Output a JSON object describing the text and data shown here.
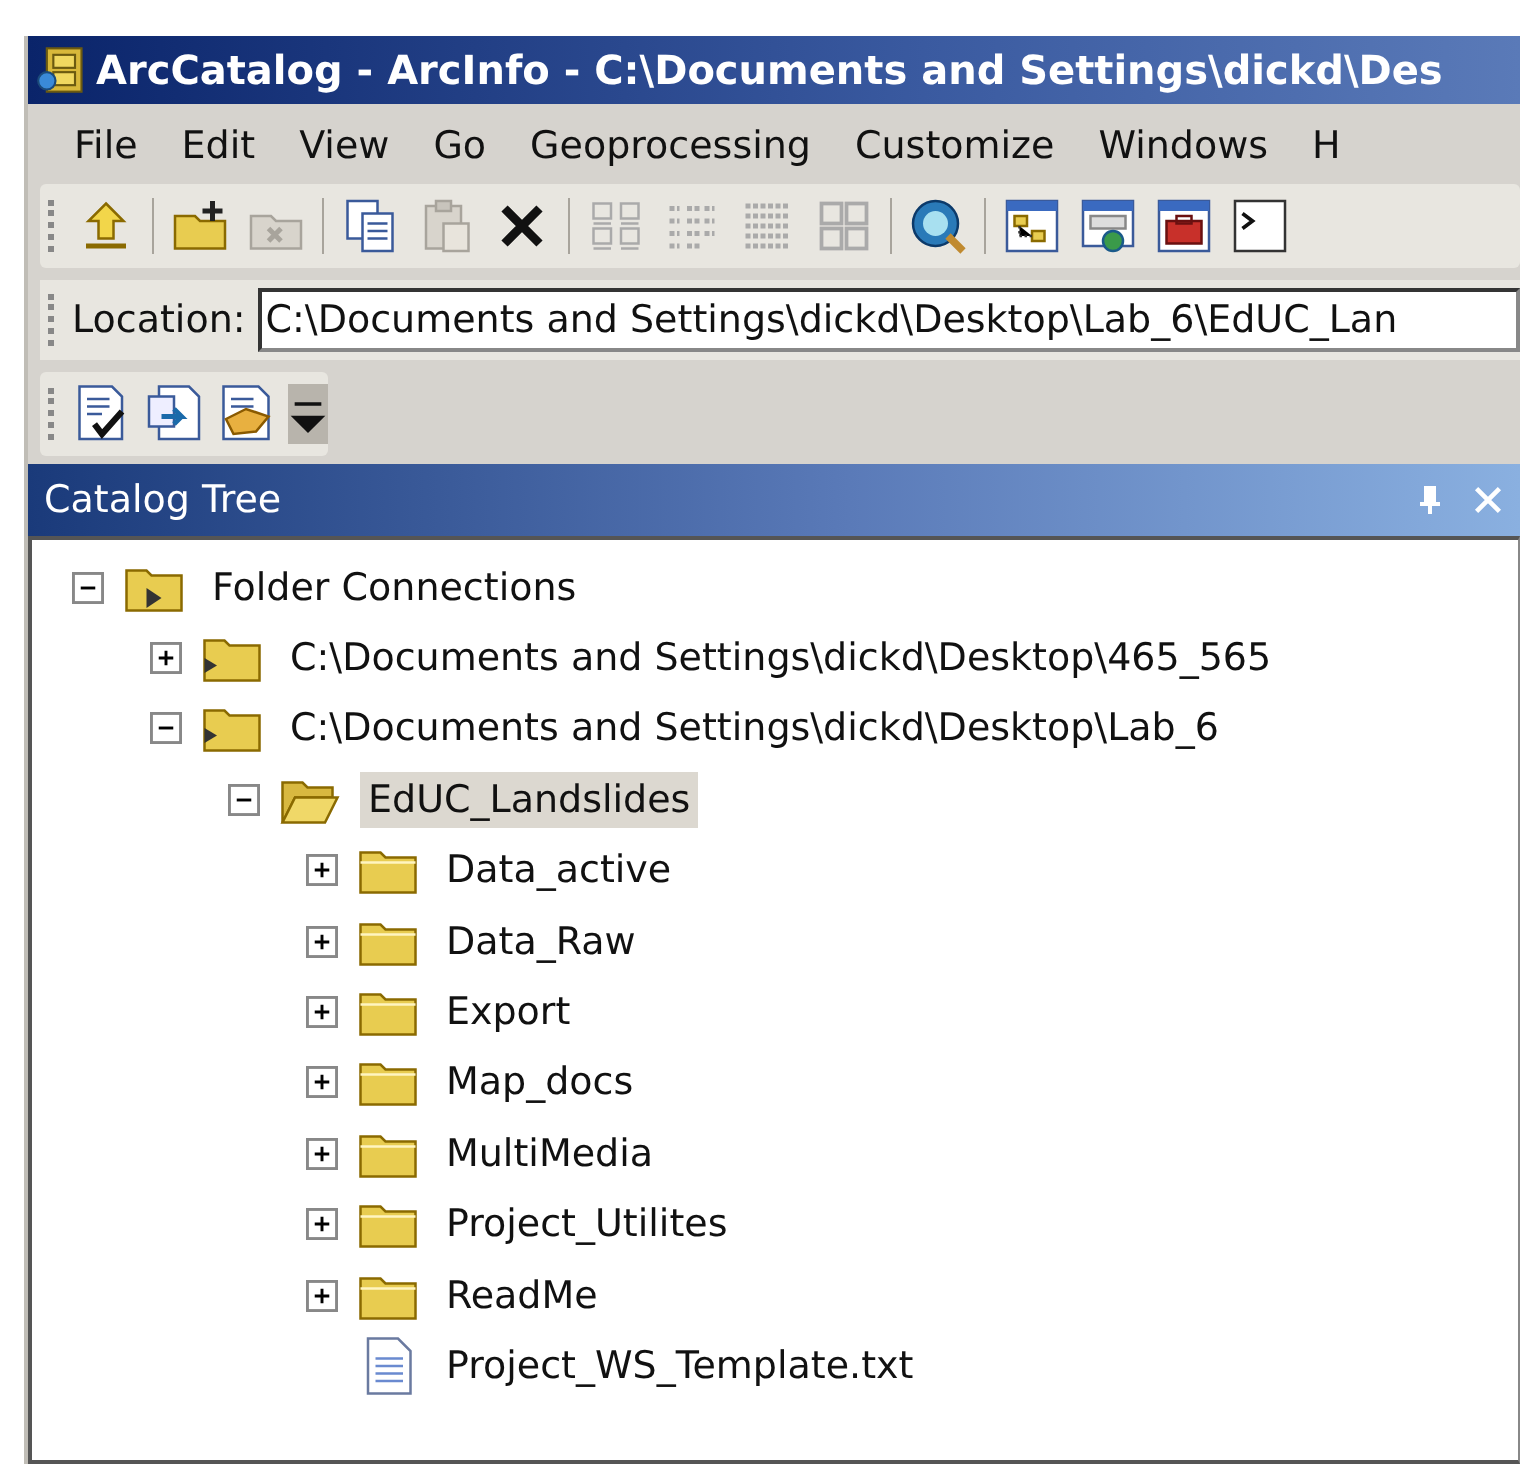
{
  "window": {
    "title": "ArcCatalog - ArcInfo - C:\\Documents and Settings\\dickd\\Des"
  },
  "menu": [
    "File",
    "Edit",
    "View",
    "Go",
    "Geoprocessing",
    "Customize",
    "Windows",
    "H"
  ],
  "location": {
    "label": "Location:",
    "value": "C:\\Documents and Settings\\dickd\\Desktop\\Lab_6\\EdUC_Lan"
  },
  "catalog_tree": {
    "title": "Catalog Tree",
    "items": [
      {
        "label": "Folder Connections",
        "kind": "connections",
        "expanded": true,
        "selected": false,
        "children": [
          {
            "label": "C:\\Documents and Settings\\dickd\\Desktop\\465_565",
            "kind": "connection",
            "expanded": false,
            "selected": false
          },
          {
            "label": "C:\\Documents and Settings\\dickd\\Desktop\\Lab_6",
            "kind": "connection",
            "expanded": true,
            "selected": false,
            "children": [
              {
                "label": "EdUC_Landslides",
                "kind": "folder",
                "expanded": true,
                "selected": true,
                "children": [
                  {
                    "label": "Data_active",
                    "kind": "folder",
                    "expanded": false,
                    "selected": false
                  },
                  {
                    "label": "Data_Raw",
                    "kind": "folder",
                    "expanded": false,
                    "selected": false
                  },
                  {
                    "label": "Export",
                    "kind": "folder",
                    "expanded": false,
                    "selected": false
                  },
                  {
                    "label": "Map_docs",
                    "kind": "folder",
                    "expanded": false,
                    "selected": false
                  },
                  {
                    "label": "MultiMedia",
                    "kind": "folder",
                    "expanded": false,
                    "selected": false
                  },
                  {
                    "label": "Project_Utilites",
                    "kind": "folder",
                    "expanded": false,
                    "selected": false
                  },
                  {
                    "label": "ReadMe",
                    "kind": "folder",
                    "expanded": false,
                    "selected": false
                  },
                  {
                    "label": "Project_WS_Template.txt",
                    "kind": "file",
                    "selected": false
                  }
                ]
              }
            ]
          }
        ]
      }
    ]
  }
}
